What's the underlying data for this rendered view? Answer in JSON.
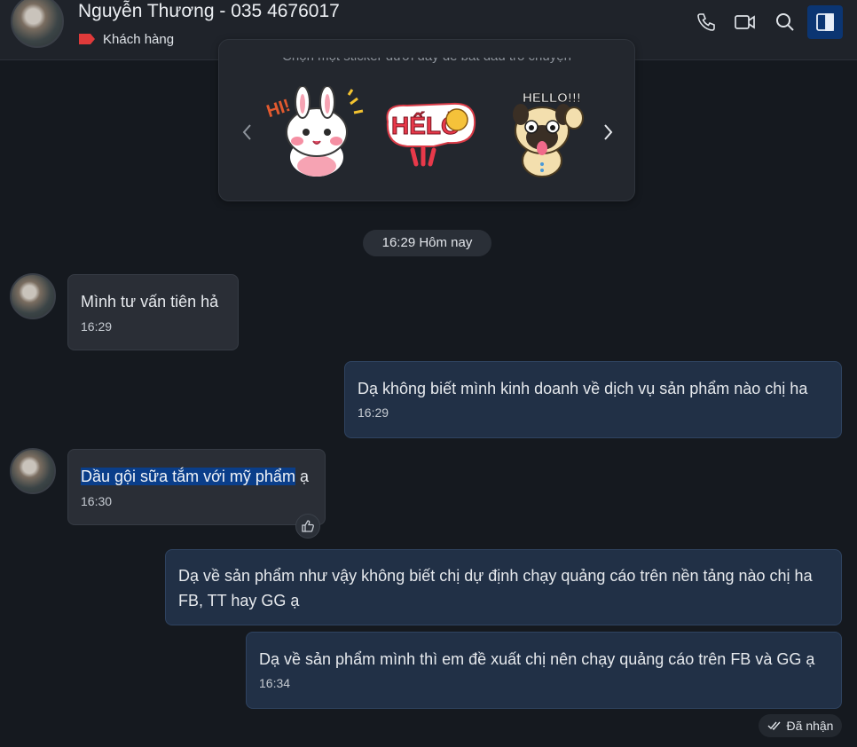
{
  "header": {
    "contact_name": "Nguyễn Thương - 035 4676017",
    "tag_label": "Khách hàng",
    "tag_color": "#e03a3a",
    "icons": [
      "phone-icon",
      "video-call-icon",
      "search-icon",
      "sidebar-panel-icon"
    ]
  },
  "sticker_suggestions": {
    "hint": "Chọn một sticker dưới đây để bắt đầu trò chuyện",
    "stickers": [
      {
        "name": "bunny-hi-sticker",
        "text": "HI!"
      },
      {
        "name": "hello-text-sticker",
        "text": "HẾLỞ"
      },
      {
        "name": "pug-hello-sticker",
        "text": "HELLO!!!"
      }
    ]
  },
  "time_divider": "16:29 Hôm nay",
  "messages": [
    {
      "direction": "in",
      "text": "Mình tư vấn tiên hả",
      "time": "16:29"
    },
    {
      "direction": "out",
      "text": "Dạ không biết mình kinh doanh về dịch vụ sản phẩm nào chị ha",
      "time": "16:29"
    },
    {
      "direction": "in",
      "text_highlighted": "Dầu gội sữa tắm với mỹ phẩm",
      "text_rest": " ạ",
      "time": "16:30"
    },
    {
      "direction": "out",
      "text": "Dạ về sản phẩm như vậy không biết chị dự định chạy quảng cáo trên nền tảng nào chị ha FB, TT hay GG ạ",
      "time": ""
    },
    {
      "direction": "out",
      "text": "Dạ về sản phẩm mình thì em đề xuất chị nên chạy quảng cáo trên FB và GG ạ",
      "time": "16:34"
    }
  ],
  "status": {
    "received_label": "Đã nhận"
  },
  "colors": {
    "accent": "#0b3572",
    "highlight": "#0a3e8a",
    "outgoing_bubble": "#213046",
    "incoming_bubble": "#2a2e36"
  }
}
